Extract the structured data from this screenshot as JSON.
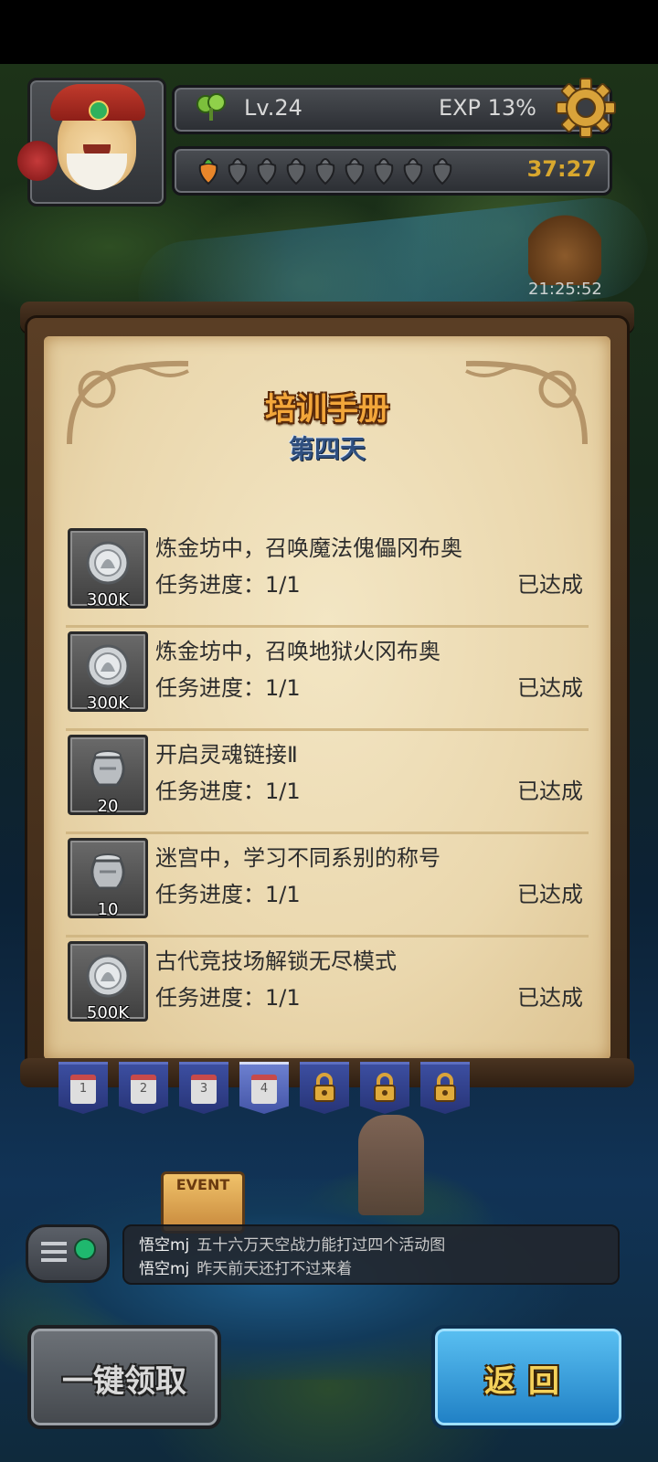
{
  "hud": {
    "level": "Lv.24",
    "exp": "EXP 13%",
    "stamina_timer": "37:27",
    "stamina_filled": 1,
    "stamina_max": 9,
    "clock": "21:25:52"
  },
  "panel": {
    "title": "培训手册",
    "subtitle": "第四天",
    "tasks": [
      {
        "name": "炼金坊中，召唤魔法傀儡冈布奥",
        "progress": "任务进度：1/1",
        "status": "已达成",
        "reward_qty": "300K",
        "reward_icon": "silver-coin-icon"
      },
      {
        "name": "炼金坊中，召唤地狱火冈布奥",
        "progress": "任务进度：1/1",
        "status": "已达成",
        "reward_qty": "300K",
        "reward_icon": "silver-coin-icon"
      },
      {
        "name": "开启灵魂链接Ⅱ",
        "progress": "任务进度：1/1",
        "status": "已达成",
        "reward_qty": "20",
        "reward_icon": "urn-icon"
      },
      {
        "name": "迷宫中，学习不同系别的称号",
        "progress": "任务进度：1/1",
        "status": "已达成",
        "reward_qty": "10",
        "reward_icon": "urn-icon"
      },
      {
        "name": "古代竞技场解锁无尽模式",
        "progress": "任务进度：1/1",
        "status": "已达成",
        "reward_qty": "500K",
        "reward_icon": "silver-coin-icon"
      }
    ]
  },
  "day_tabs": [
    {
      "label": "1",
      "locked": false,
      "active": false
    },
    {
      "label": "2",
      "locked": false,
      "active": false
    },
    {
      "label": "3",
      "locked": false,
      "active": false
    },
    {
      "label": "4",
      "locked": false,
      "active": true
    },
    {
      "label": "",
      "locked": true,
      "active": false
    },
    {
      "label": "",
      "locked": true,
      "active": false
    },
    {
      "label": "",
      "locked": true,
      "active": false
    }
  ],
  "map": {
    "event_sign": "EVENT"
  },
  "chat": {
    "messages": [
      {
        "user": "悟空mj",
        "text": "五十六万天空战力能打过四个活动图"
      },
      {
        "user": "悟空mj",
        "text": "昨天前天还打不过来着"
      }
    ]
  },
  "buttons": {
    "claim_all": "一键领取",
    "back": "返回"
  },
  "colors": {
    "title_orange": "#f2a63a",
    "subtitle_blue": "#2f4f7f",
    "timer_gold": "#d9a82e",
    "back_button_blue": "#1f7fc4"
  }
}
